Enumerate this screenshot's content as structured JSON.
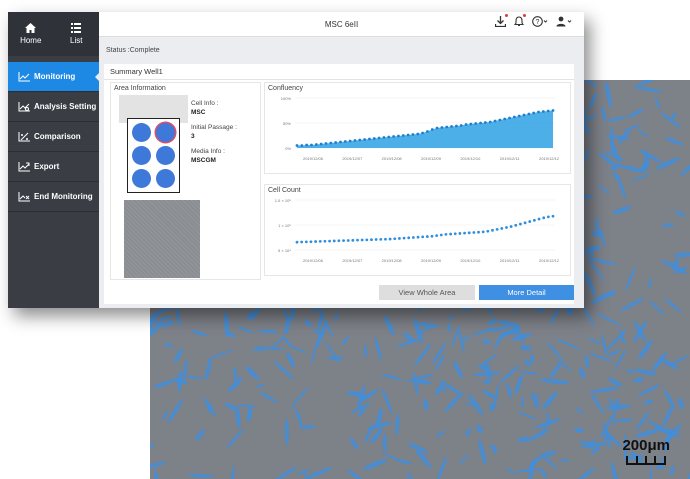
{
  "sidebar": {
    "home_label": "Home",
    "list_label": "List",
    "items": [
      {
        "label": "Monitoring",
        "icon": "line-chart-icon",
        "active": true
      },
      {
        "label": "Analysis Setting",
        "icon": "analysis-chart-icon",
        "active": false
      },
      {
        "label": "Comparison",
        "icon": "comparison-icon",
        "active": false
      },
      {
        "label": "Export",
        "icon": "export-chart-icon",
        "active": false
      },
      {
        "label": "End Monitoring",
        "icon": "end-chart-icon",
        "active": false
      }
    ]
  },
  "header": {
    "title": "MSC 6eII",
    "icons": [
      "download-icon",
      "bell-icon",
      "help-icon",
      "user-icon"
    ]
  },
  "status": "Status :Complete",
  "panel": {
    "title": "Summary Well1",
    "area_title": "Area Information",
    "cell_info_label": "Cell Info :",
    "cell_info_value": "MSC",
    "initial_passage_label": "Initial Passage :",
    "initial_passage_value": "3",
    "media_info_label": "Media Info :",
    "media_info_value": "MSCGM",
    "view_whole_area": "View Whole Area",
    "more_detail": "More Detail"
  },
  "chart_data": [
    {
      "type": "area",
      "title": "Confluency",
      "y_ticks": [
        "100%",
        "50%",
        "0%"
      ],
      "x_ticks": [
        "2019/12/06",
        "2019/12/07",
        "2019/12/08",
        "2019/12/09",
        "2019/12/10",
        "2019/12/11",
        "2019/12/12"
      ],
      "ylim": [
        0,
        100
      ],
      "color": "#3aa6e6",
      "values": [
        5,
        5,
        6,
        6,
        7,
        8,
        9,
        10,
        11,
        12,
        13,
        14,
        15,
        16,
        17,
        18,
        19,
        20,
        21,
        22,
        23,
        24,
        25,
        26,
        27,
        28,
        30,
        33,
        37,
        40,
        41,
        42,
        43,
        44,
        45,
        47,
        48,
        49,
        50,
        51,
        52,
        54,
        56,
        58,
        60,
        62,
        64,
        66,
        68,
        70,
        72,
        73,
        74,
        75
      ]
    },
    {
      "type": "scatter",
      "title": "Cell Count",
      "y_ticks": [
        "1.5 × 10⁵",
        "1 × 10⁵",
        "5 × 10⁴"
      ],
      "x_ticks": [
        "2019/12/06",
        "2019/12/07",
        "2019/12/08",
        "2019/12/09",
        "2019/12/10",
        "2019/12/11",
        "2019/12/12"
      ],
      "ylim": [
        0,
        160000
      ],
      "color": "#2f8fde",
      "values": [
        25000,
        25500,
        26000,
        26500,
        27000,
        27500,
        28000,
        28500,
        29000,
        29500,
        30000,
        30500,
        31000,
        31500,
        32000,
        32500,
        33000,
        33500,
        34000,
        34500,
        35000,
        36000,
        37000,
        38000,
        39000,
        40000,
        41000,
        42000,
        43000,
        44000,
        46000,
        48000,
        50000,
        51000,
        52000,
        53000,
        54000,
        55000,
        56000,
        57000,
        58000,
        60000,
        63000,
        66000,
        69000,
        72000,
        75000,
        79000,
        83000,
        87000,
        91000,
        95000,
        99000,
        103000,
        106000,
        108000
      ]
    }
  ],
  "scale_bar": "200μm"
}
